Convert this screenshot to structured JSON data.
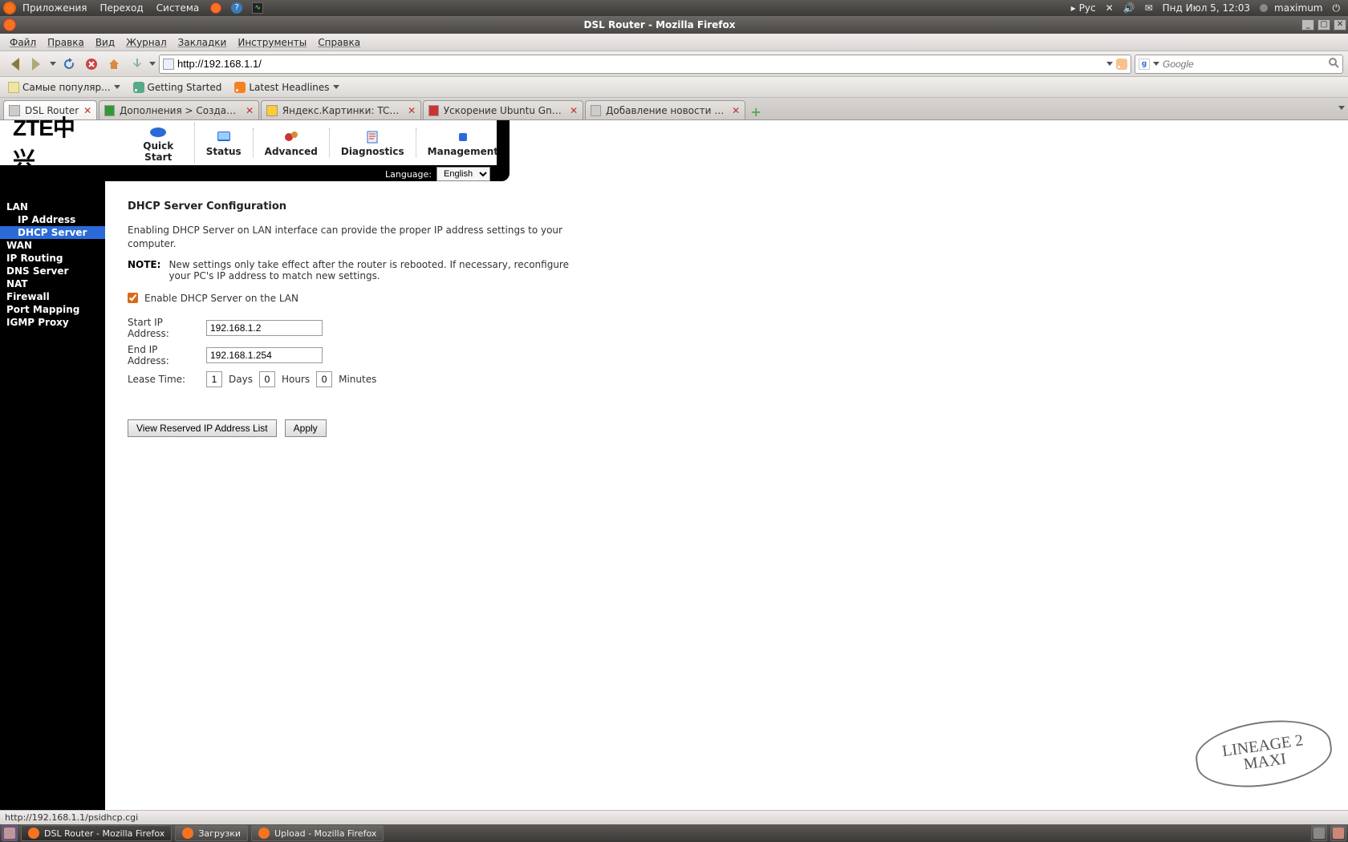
{
  "system_bar": {
    "apps": "Приложения",
    "places": "Переход",
    "system": "Система",
    "lang_ind": "Рус",
    "date": "Пнд Июл  5, 12:03",
    "user": "maximum"
  },
  "window": {
    "title": "DSL Router - Mozilla Firefox"
  },
  "ff_menu": {
    "file": "Файл",
    "edit": "Правка",
    "view": "Вид",
    "history": "Журнал",
    "bookmarks": "Закладки",
    "tools": "Инструменты",
    "help": "Справка"
  },
  "nav": {
    "url": "http://192.168.1.1/",
    "search_placeholder": "Google"
  },
  "bookmarks_bar": {
    "popular": "Самые популяр...",
    "getting_started": "Getting Started",
    "headlines": "Latest Headlines"
  },
  "tabs": {
    "t0": "DSL Router",
    "t1": "Дополнения > Создание...",
    "t2": "Яндекс.Картинки: TCP/IP",
    "t3": "Ускорение Ubuntu Gnome...",
    "t4": "Добавление новости » Li..."
  },
  "router_nav": {
    "quick": "Quick Start",
    "status": "Status",
    "advanced": "Advanced",
    "diag": "Diagnostics",
    "mgmt": "Management",
    "lang_label": "Language:",
    "lang_val": "English"
  },
  "logo": "ZTE中兴",
  "sidebar": {
    "lan": "LAN",
    "ip": "IP Address",
    "dhcp": "DHCP Server",
    "wan": "WAN",
    "iprouting": "IP Routing",
    "dns": "DNS Server",
    "nat": "NAT",
    "firewall": "Firewall",
    "port": "Port Mapping",
    "igmp": "IGMP Proxy"
  },
  "content": {
    "heading": "DHCP Server Configuration",
    "desc": "Enabling DHCP Server on LAN interface can provide the proper IP address settings to your computer.",
    "note_label": "NOTE:",
    "note_text": "New settings only take effect after the router is rebooted. If necessary, reconfigure your PC's IP address to match new settings.",
    "enable_label": "Enable DHCP Server on the LAN",
    "start_label": "Start IP Address:",
    "start_val": "192.168.1.2",
    "end_label": "End IP Address:",
    "end_val": "192.168.1.254",
    "lease_label": "Lease Time:",
    "lease_days": "1",
    "days_txt": "Days",
    "lease_hours": "0",
    "hours_txt": "Hours",
    "lease_mins": "0",
    "mins_txt": "Minutes",
    "btn_reserved": "View Reserved IP Address List",
    "btn_apply": "Apply"
  },
  "statusbar": {
    "text": "http://192.168.1.1/psidhcp.cgi"
  },
  "taskbar": {
    "t1": "DSL Router - Mozilla Firefox",
    "t2": "Загрузки",
    "t3": "Upload - Mozilla Firefox"
  },
  "watermark": {
    "l1": "LINEAGE 2",
    "l2": "MAXI"
  }
}
